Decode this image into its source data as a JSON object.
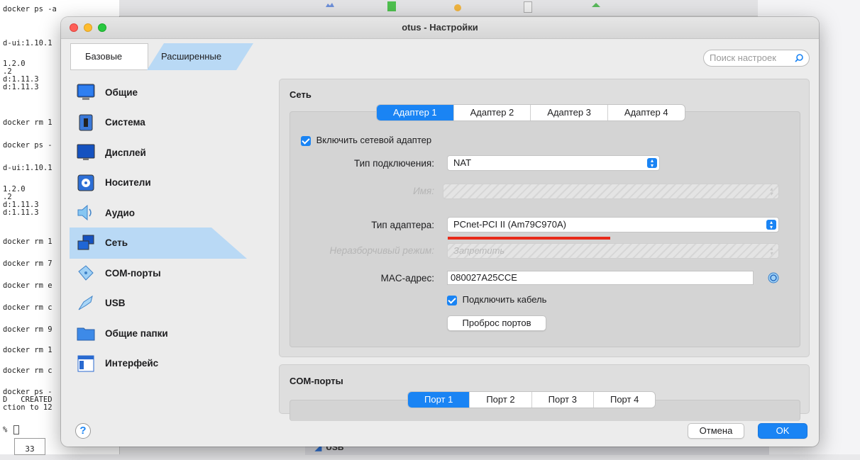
{
  "terminal": {
    "lines": [
      "docker ps -a",
      "d-ui:1.10.1",
      "1.2.0",
      ".2",
      "d:1.11.3",
      "d:1.11.3",
      "docker rm 1",
      "docker ps -",
      "d-ui:1.10.1",
      "1.2.0",
      ".2",
      "d:1.11.3",
      "d:1.11.3",
      "docker rm 1",
      "docker rm 7",
      "docker rm e",
      "docker rm c",
      "docker rm 9",
      "docker rm 1",
      "docker rm c",
      "docker ps -",
      "D   CREATED",
      "ction to 12",
      "% "
    ],
    "bottom_number": "33"
  },
  "background_window": {
    "bottom_label": "USB"
  },
  "dialog": {
    "title": "otus - Настройки",
    "mode_tabs": {
      "basic": "Базовые",
      "advanced": "Расширенные"
    },
    "search_placeholder": "Поиск настроек",
    "sidebar": {
      "items": [
        {
          "label": "Общие",
          "icon": "general-icon"
        },
        {
          "label": "Система",
          "icon": "system-icon"
        },
        {
          "label": "Дисплей",
          "icon": "display-icon"
        },
        {
          "label": "Носители",
          "icon": "storage-icon"
        },
        {
          "label": "Аудио",
          "icon": "audio-icon"
        },
        {
          "label": "Сеть",
          "icon": "network-icon",
          "active": true
        },
        {
          "label": "COM-порты",
          "icon": "serial-ports-icon"
        },
        {
          "label": "USB",
          "icon": "usb-icon"
        },
        {
          "label": "Общие папки",
          "icon": "shared-folders-icon"
        },
        {
          "label": "Интерфейс",
          "icon": "user-interface-icon"
        }
      ]
    },
    "network": {
      "title": "Сеть",
      "adapter_tabs": [
        "Адаптер 1",
        "Адаптер 2",
        "Адаптер 3",
        "Адаптер 4"
      ],
      "selected_tab": "Адаптер 1",
      "enable_adapter_label": "Включить сетевой адаптер",
      "enable_adapter_checked": true,
      "attached_to_label": "Тип подключения:",
      "attached_to_value": "NAT",
      "name_label": "Имя:",
      "adapter_type_label": "Тип адаптера:",
      "adapter_type_value": "PCnet-PCI II (Am79C970A)",
      "promiscuous_label": "Неразборчивый режим:",
      "promiscuous_value": "Запретить",
      "mac_label": "MAC-адрес:",
      "mac_value": "080027A25CCE",
      "cable_connected_label": "Подключить кабель",
      "cable_connected_checked": true,
      "port_forwarding_button": "Проброс портов"
    },
    "com_ports": {
      "title": "COM-порты",
      "port_tabs": [
        "Порт 1",
        "Порт 2",
        "Порт 3",
        "Порт 4"
      ],
      "selected_tab": "Порт 1"
    },
    "buttons": {
      "cancel": "Отмена",
      "ok": "OK",
      "help": "?"
    }
  },
  "colors": {
    "accent": "#1a84f4",
    "selection": "#b9d9f5",
    "annotation_red": "#e82a1a"
  }
}
